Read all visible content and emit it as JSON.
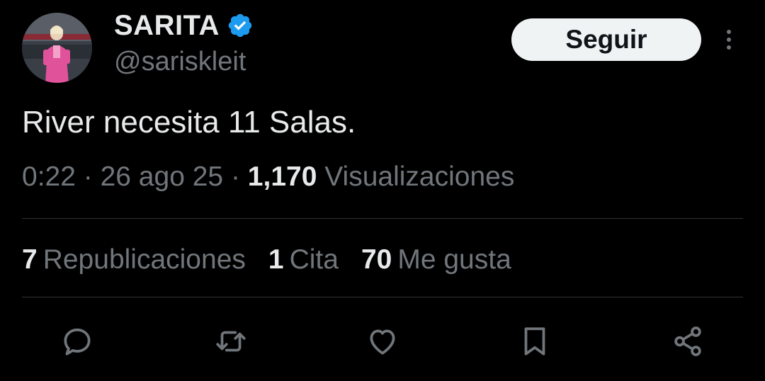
{
  "author": {
    "display_name": "SARITA",
    "handle": "@sariskleit",
    "verified": true,
    "verified_icon": "verified-badge-icon",
    "avatar": "avatar"
  },
  "header": {
    "follow_label": "Seguir",
    "more_icon": "more-vertical-icon"
  },
  "tweet": {
    "text": "River necesita 11 Salas.",
    "time": "0:22",
    "sep": "·",
    "date": "26 ago 25",
    "views_count": "1,170",
    "views_label": "Visualizaciones"
  },
  "stats": {
    "reposts_count": "7",
    "reposts_label": "Republicaciones",
    "quotes_count": "1",
    "quotes_label": "Cita",
    "likes_count": "70",
    "likes_label": "Me gusta"
  },
  "actions": [
    "reply-icon",
    "repost-icon",
    "like-icon",
    "bookmark-icon",
    "share-icon"
  ],
  "colors": {
    "background": "#000000",
    "primary_text": "#e7e9ea",
    "secondary_text": "#71767b",
    "divider": "#2f3336",
    "verified": "#1d9bf0",
    "follow_bg": "#eff3f4"
  }
}
